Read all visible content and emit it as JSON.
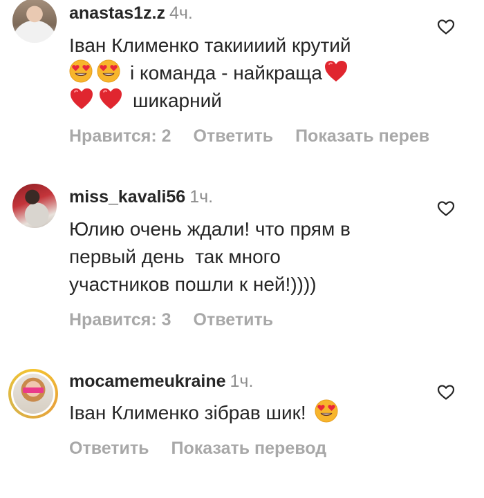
{
  "comments": [
    {
      "username": "anastas1z.z",
      "time": "4ч.",
      "lines": [
        "Іван Клименко такиииий крутий",
        "і команда - найкраща",
        "шикарний"
      ],
      "actions": {
        "likes": "Нравится: 2",
        "reply": "Ответить",
        "translate": "Показать перев"
      }
    },
    {
      "username": "miss_kavali56",
      "time": "1ч.",
      "lines": [
        "Юлию очень ждали! что прям в",
        "первый день  так много",
        "участников пошли к ней!))))"
      ],
      "actions": {
        "likes": "Нравится: 3",
        "reply": "Ответить"
      }
    },
    {
      "username": "mocamemeukraine",
      "time": "1ч.",
      "lines": [
        "Іван Клименко зібрав шик!"
      ],
      "actions": {
        "reply": "Ответить",
        "translate": "Показать перевод"
      }
    }
  ],
  "colors": {
    "text": "#262626",
    "muted": "#8e8e8e",
    "action": "#a8a8a8",
    "heart_red": "#e0262f",
    "emoji_yellow": "#f7b52c"
  },
  "icons": {
    "like": "heart-outline-icon",
    "heart_emoji": "red-heart-emoji",
    "face_emoji": "smiling-face-heart-eyes-emoji"
  }
}
